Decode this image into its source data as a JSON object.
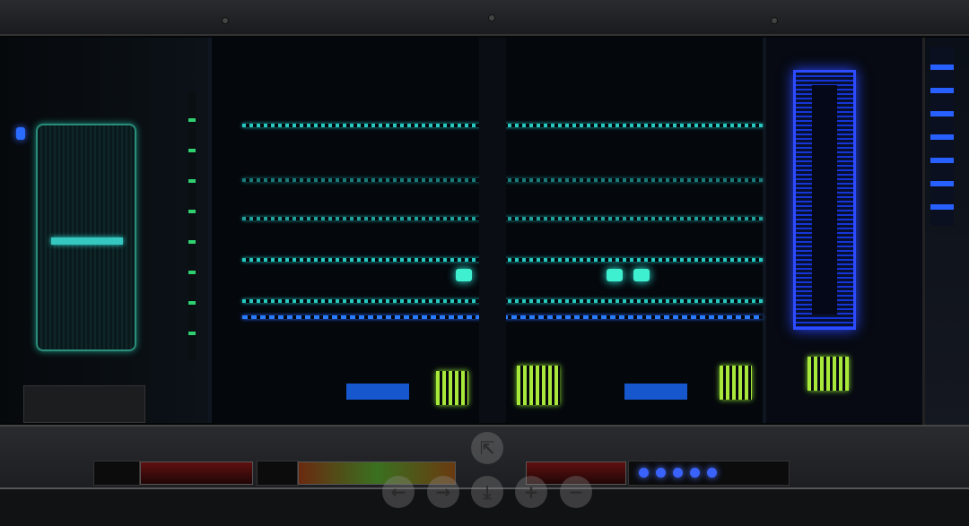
{
  "viewer_controls": {
    "share": "share-icon",
    "previous": "arrow-left-icon",
    "next": "arrow-right-icon",
    "download": "download-icon",
    "zoom_in": "plus-icon",
    "zoom_out": "minus-icon",
    "glyphs": {
      "share": "⇱",
      "previous": "←",
      "next": "→",
      "download": "⤓",
      "zoom_in": "+",
      "zoom_out": "−"
    }
  },
  "colors": {
    "teal": "#27c8c0",
    "blue": "#2e4cff",
    "green": "#a8e83a",
    "frame": "#2a2b2e"
  }
}
